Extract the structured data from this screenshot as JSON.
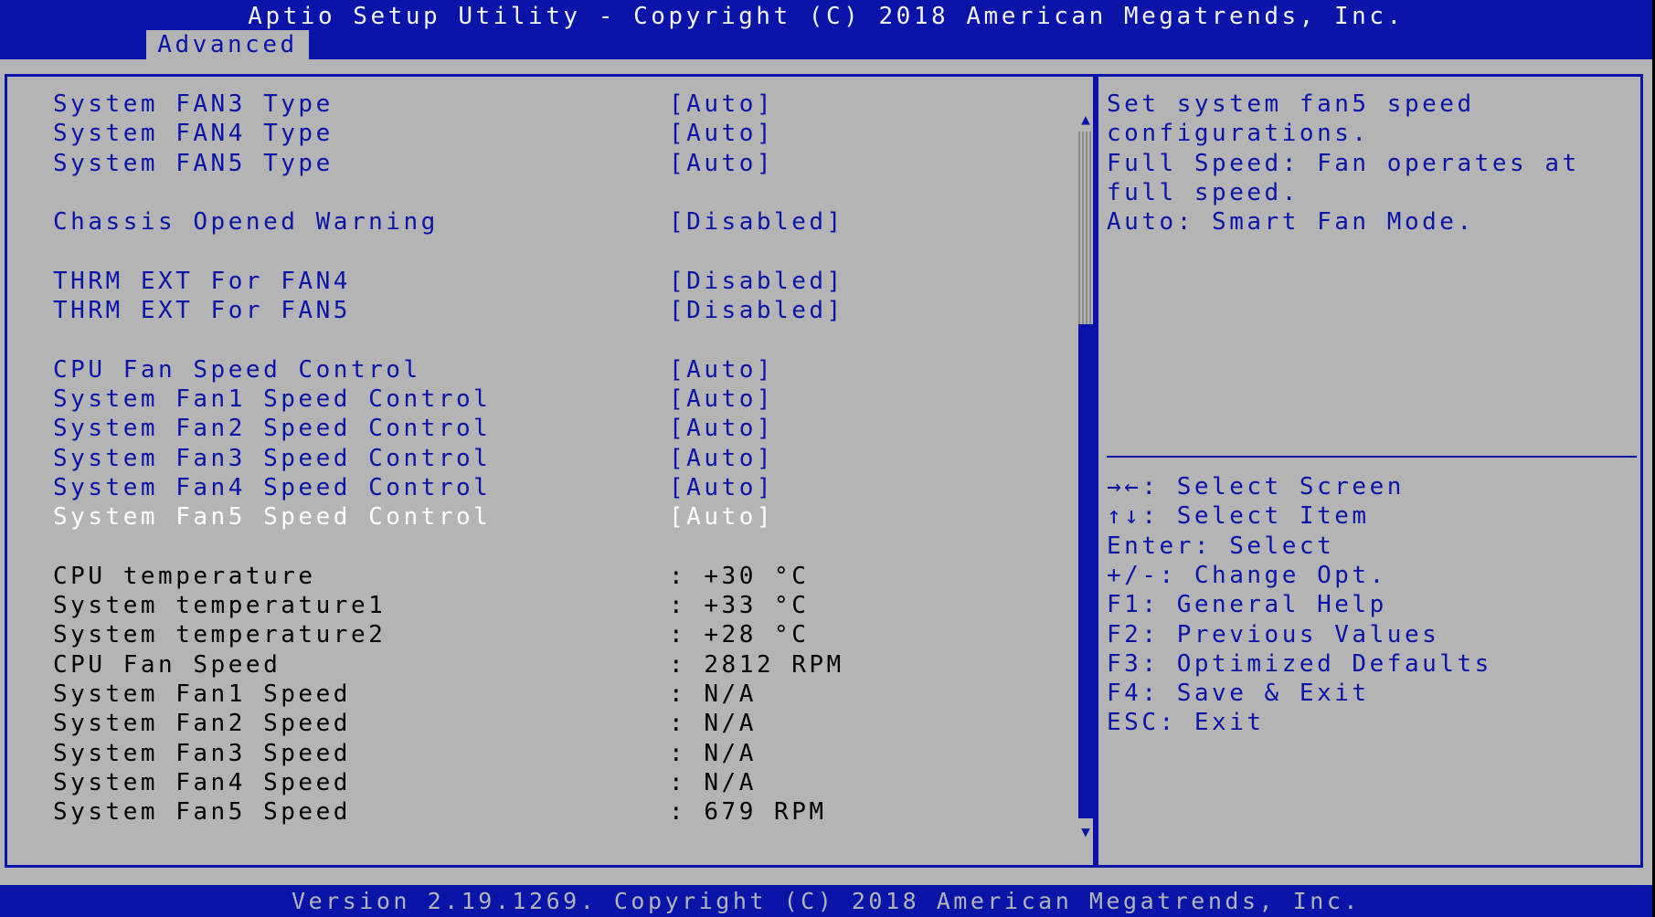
{
  "header": {
    "title": "Aptio Setup Utility - Copyright (C) 2018 American Megatrends, Inc.",
    "active_tab": "Advanced"
  },
  "settings": [
    {
      "label": "System FAN3 Type",
      "value": "[Auto]",
      "kind": "option"
    },
    {
      "label": "System FAN4 Type",
      "value": "[Auto]",
      "kind": "option"
    },
    {
      "label": "System FAN5 Type",
      "value": "[Auto]",
      "kind": "option"
    },
    {
      "label": "Chassis Opened Warning",
      "value": "[Disabled]",
      "kind": "option"
    },
    {
      "label": "THRM EXT For FAN4",
      "value": "[Disabled]",
      "kind": "option"
    },
    {
      "label": "THRM EXT For FAN5",
      "value": "[Disabled]",
      "kind": "option"
    },
    {
      "label": "CPU Fan Speed Control",
      "value": "[Auto]",
      "kind": "option"
    },
    {
      "label": "System Fan1 Speed Control",
      "value": "[Auto]",
      "kind": "option"
    },
    {
      "label": "System Fan2 Speed Control",
      "value": "[Auto]",
      "kind": "option"
    },
    {
      "label": "System Fan3 Speed Control",
      "value": "[Auto]",
      "kind": "option"
    },
    {
      "label": "System Fan4 Speed Control",
      "value": "[Auto]",
      "kind": "option"
    },
    {
      "label": "System Fan5 Speed Control",
      "value": "[Auto]",
      "kind": "option",
      "selected": true
    },
    {
      "label": "CPU temperature",
      "value": ": +30 °C",
      "kind": "info"
    },
    {
      "label": "System temperature1",
      "value": ": +33 °C",
      "kind": "info"
    },
    {
      "label": "System temperature2",
      "value": ": +28 °C",
      "kind": "info"
    },
    {
      "label": "CPU Fan Speed",
      "value": ": 2812 RPM",
      "kind": "info"
    },
    {
      "label": "System Fan1 Speed",
      "value": ": N/A",
      "kind": "info"
    },
    {
      "label": "System Fan2 Speed",
      "value": ": N/A",
      "kind": "info"
    },
    {
      "label": "System Fan3 Speed",
      "value": ": N/A",
      "kind": "info"
    },
    {
      "label": "System Fan4 Speed",
      "value": ": N/A",
      "kind": "info"
    },
    {
      "label": "System Fan5 Speed",
      "value": ": 679 RPM",
      "kind": "info"
    }
  ],
  "scrollbar": {
    "up_icon": "▲",
    "down_icon": "▼",
    "thumb_start_fraction": 0.28,
    "thumb_end_fraction": 1.0
  },
  "help": {
    "lines": [
      "Set system fan5 speed",
      "configurations.",
      "Full Speed: Fan operates at",
      "full speed.",
      "Auto: Smart Fan Mode."
    ],
    "keys": [
      "→←: Select Screen",
      "↑↓: Select Item",
      "Enter: Select",
      "+/-: Change Opt.",
      "F1: General Help",
      "F2: Previous Values",
      "F3: Optimized Defaults",
      "F4: Save & Exit",
      "ESC: Exit"
    ]
  },
  "footer": {
    "text": "Version 2.19.1269. Copyright (C) 2018 American Megatrends, Inc."
  },
  "colors": {
    "bios_blue": "#0a14a8",
    "panel_gray": "#b4b4b4",
    "highlight_white": "#ffffff",
    "info_text": "#000000"
  }
}
